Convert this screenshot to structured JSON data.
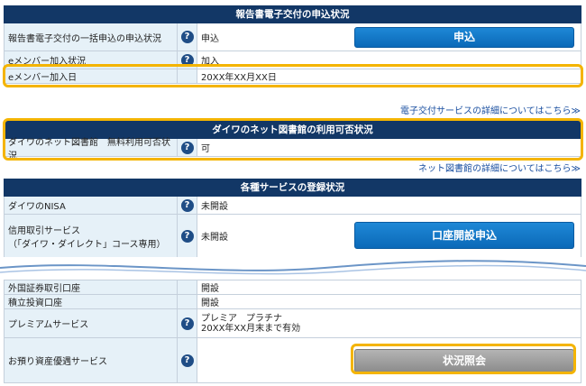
{
  "report": {
    "header": "報告書電子交付の申込状況",
    "rows": [
      {
        "label": "報告書電子交付の一括申込の申込状況",
        "value": "申込"
      },
      {
        "label": "eメンバー加入状況",
        "value": "加入"
      },
      {
        "label": "eメンバー加入日",
        "value": "20XX年XX月XX日"
      }
    ],
    "apply_button": "申込",
    "link": "電子交付サービスの詳細についてはこちら≫"
  },
  "library": {
    "header": "ダイワのネット図書館の利用可否状況",
    "row": {
      "label": "ダイワのネット図書館　無料利用可否状況",
      "value": "可"
    },
    "link": "ネット図書館の詳細についてはこちら≫"
  },
  "services": {
    "header": "各種サービスの登録状況",
    "nisa": {
      "label": "ダイワのNISA",
      "value": "未開設"
    },
    "margin": {
      "label1": "信用取引サービス",
      "label2": "（「ダイワ・ダイレクト」コース専用）",
      "value": "未開設"
    },
    "open_account_button": "口座開設申込",
    "foreign": {
      "label": "外国証券取引口座",
      "value": "開設"
    },
    "tsumitate": {
      "label": "積立投資口座",
      "value": "開設"
    },
    "premium": {
      "label": "プレミアムサービス",
      "value1": "プレミア　プラチナ",
      "value2": "20XX年XX月末まで有効"
    },
    "deposit": {
      "label": "お預り資産優遇サービス"
    },
    "status_button": "状況照会"
  },
  "help_glyph": "?",
  "colors": {
    "header": "#123766",
    "label_bg": "#e6f1f8",
    "highlight": "#f4b400",
    "button_blue": "#0b69b8",
    "button_gray": "#8c8c8c"
  }
}
